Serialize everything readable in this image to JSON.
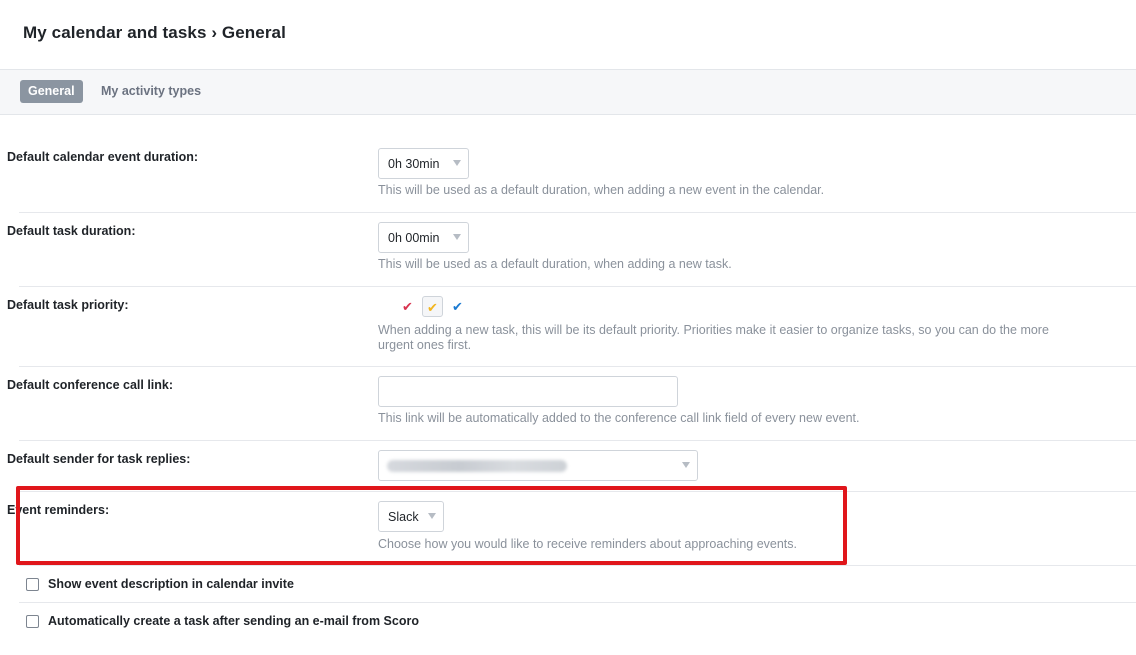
{
  "header": {
    "title": "My calendar and tasks › General"
  },
  "tabs": [
    {
      "label": "General",
      "active": true
    },
    {
      "label": "My activity types",
      "active": false
    }
  ],
  "settings": {
    "event_duration": {
      "label": "Default calendar event duration:",
      "value": "0h 30min",
      "hint": "This will be used as a default duration, when adding a new event in the calendar."
    },
    "task_duration": {
      "label": "Default task duration:",
      "value": "0h 00min",
      "hint": "This will be used as a default duration, when adding a new task."
    },
    "task_priority": {
      "label": "Default task priority:",
      "options": [
        {
          "icon": "check-icon",
          "color": "#d8344f",
          "selected": false
        },
        {
          "icon": "check-icon",
          "color": "#f2b51f",
          "selected": true
        },
        {
          "icon": "check-icon",
          "color": "#1a7ad1",
          "selected": false
        }
      ],
      "hint_line1": "When adding a new task, this will be its default priority. Priorities make it easier to organize tasks, so you can do the more",
      "hint_line2": "urgent ones first."
    },
    "conference_link": {
      "label": "Default conference call link:",
      "value": "",
      "hint": "This link will be automatically added to the conference call link field of every new event."
    },
    "task_reply_sender": {
      "label": "Default sender for task replies:"
    },
    "event_reminders": {
      "label": "Event reminders:",
      "value": "Slack",
      "hint": "Choose how you would like to receive reminders about approaching events."
    }
  },
  "checkboxes": [
    {
      "label": "Show event description in calendar invite",
      "checked": false
    },
    {
      "label": "Automatically create a task after sending an e-mail from Scoro",
      "checked": false
    }
  ],
  "colors": {
    "highlight_border": "#e0161b",
    "active_tab_bg": "#8b95a1",
    "hint_text": "#8a919b"
  }
}
